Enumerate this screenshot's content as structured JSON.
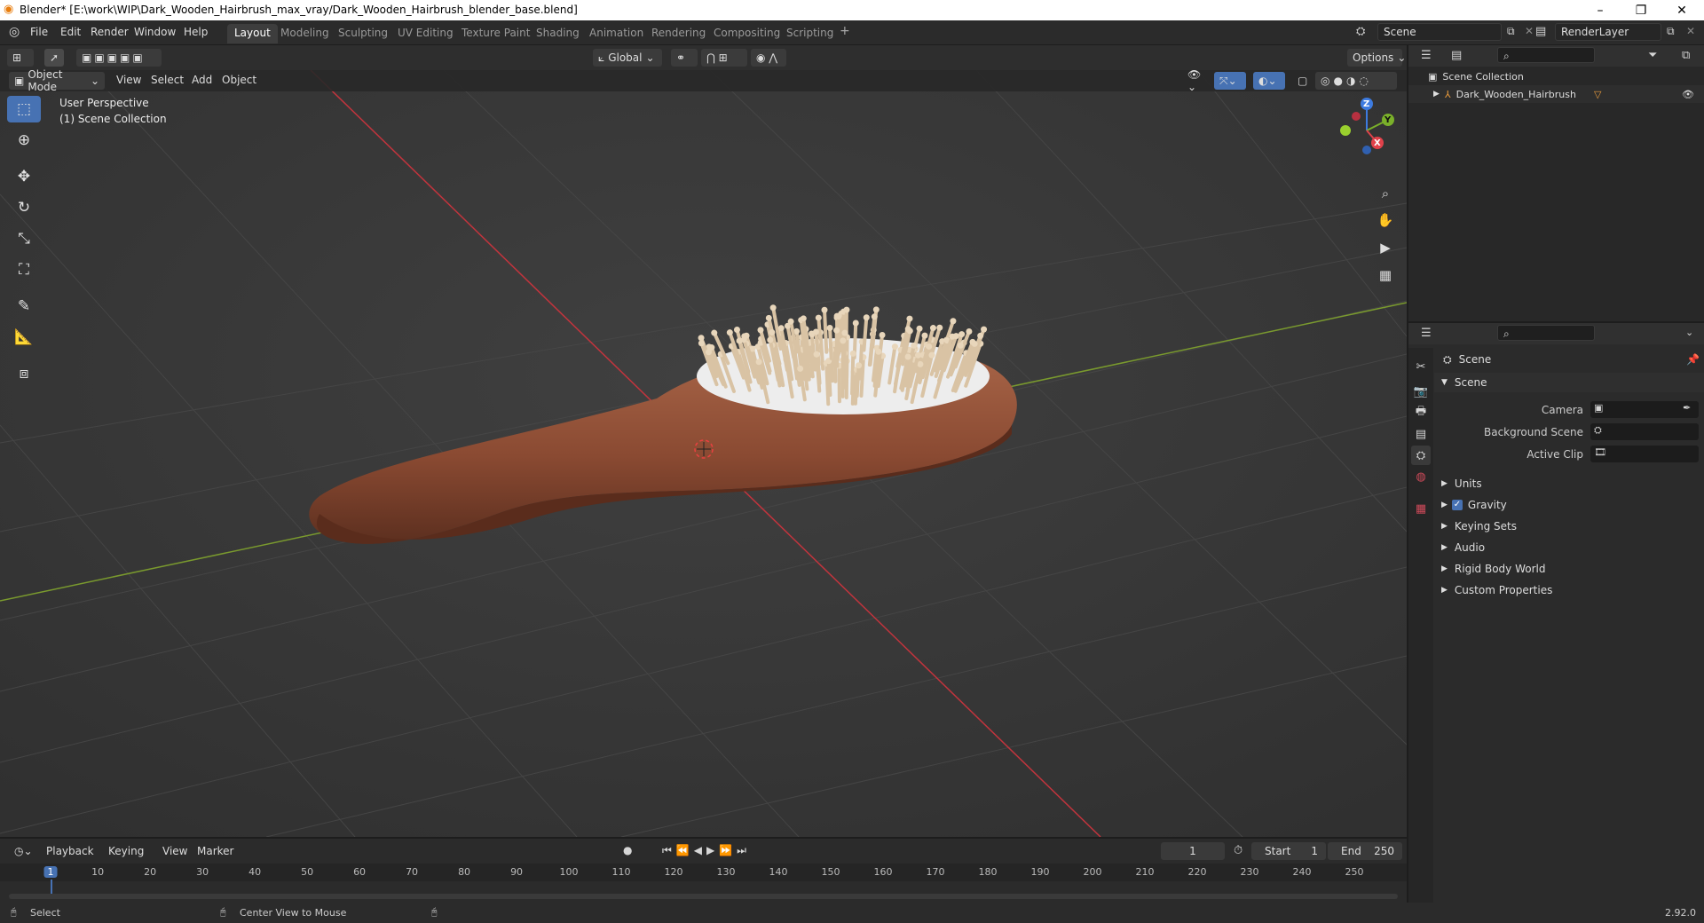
{
  "window": {
    "title": "Blender* [E:\\work\\WIP\\Dark_Wooden_Hairbrush_max_vray/Dark_Wooden_Hairbrush_blender_base.blend]",
    "minimize": "–",
    "maximize": "❐",
    "close": "✕"
  },
  "menu": [
    "File",
    "Edit",
    "Render",
    "Window",
    "Help"
  ],
  "workspaces": [
    "Layout",
    "Modeling",
    "Sculpting",
    "UV Editing",
    "Texture Paint",
    "Shading",
    "Animation",
    "Rendering",
    "Compositing",
    "Scripting"
  ],
  "active_workspace": "Layout",
  "add_workspace": "+",
  "scene_field": "Scene",
  "view_layer_field": "RenderLayer",
  "viewport": {
    "mode": "Object Mode",
    "menus": [
      "View",
      "Select",
      "Add",
      "Object"
    ],
    "transform_orientation": "Global",
    "options_label": "Options",
    "perspective_label": "User Perspective",
    "collection_label": "(1) Scene Collection",
    "gizmo": {
      "z": "Z",
      "y": "Y",
      "x": "X"
    }
  },
  "outliner": {
    "search_placeholder": "",
    "root": "Scene Collection",
    "items": [
      {
        "name": "Dark_Wooden_Hairbrush"
      }
    ]
  },
  "properties": {
    "header_name": "Scene",
    "section": "Scene",
    "fields": [
      {
        "label": "Camera"
      },
      {
        "label": "Background Scene"
      },
      {
        "label": "Active Clip"
      }
    ],
    "panels": [
      "Units",
      "Gravity",
      "Keying Sets",
      "Audio",
      "Rigid Body World",
      "Custom Properties"
    ],
    "gravity_checked": true
  },
  "timeline": {
    "menus": [
      "Playback",
      "Keying",
      "View",
      "Marker"
    ],
    "current_frame": "1",
    "start_label": "Start",
    "start": "1",
    "end_label": "End",
    "end": "250",
    "ticks": [
      "1",
      "10",
      "20",
      "30",
      "40",
      "50",
      "60",
      "70",
      "80",
      "90",
      "100",
      "110",
      "120",
      "130",
      "140",
      "150",
      "160",
      "170",
      "180",
      "190",
      "200",
      "210",
      "220",
      "230",
      "240",
      "250"
    ]
  },
  "status": {
    "left": "Select",
    "middle": "Center View to Mouse",
    "version": "2.92.0"
  },
  "colors": {
    "accent": "#4772b3",
    "grid_x": "#c2343d",
    "grid_y": "#7a9a2e",
    "wood": "#8a4a32"
  }
}
